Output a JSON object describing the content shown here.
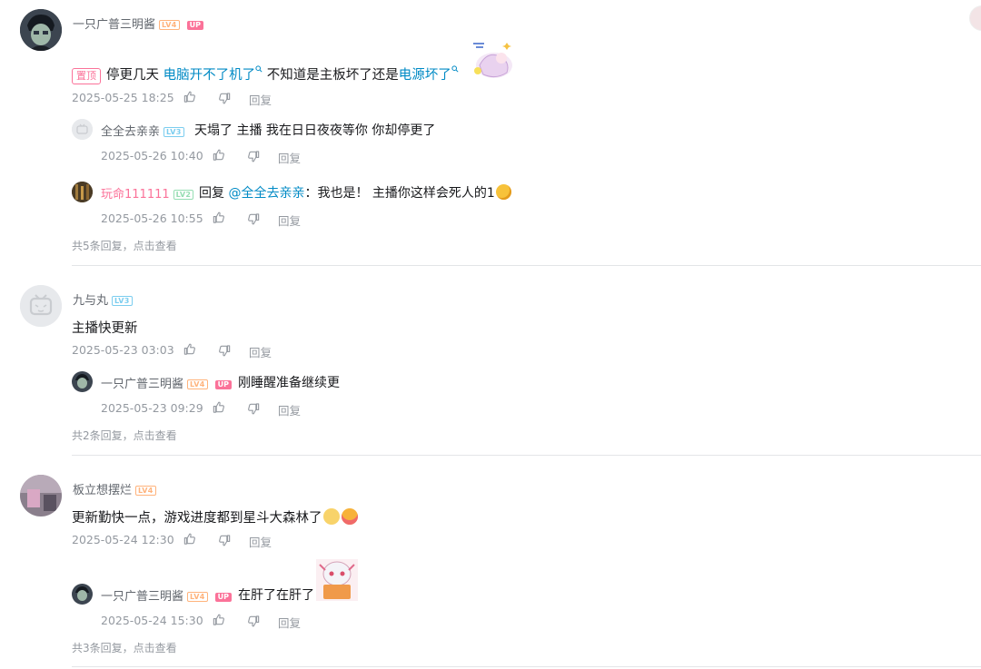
{
  "comments": [
    {
      "user": "一只广普三明酱",
      "level": "LV4",
      "up_badge": "UP",
      "pinned_label": "置顶",
      "text_parts": [
        "停更几天",
        "电脑开不了机了",
        "不知道是主板坏了还是",
        "电源坏了"
      ],
      "time": "2025-05-25 18:25",
      "reply_label": "回复",
      "replies": [
        {
          "user": "全全去亲亲",
          "level": "LV3",
          "text": "天塌了 主播 我在日日夜夜等你 你却停更了",
          "time": "2025-05-26 10:40",
          "reply_label": "回复"
        },
        {
          "user": "玩命111111",
          "level": "LV2",
          "prefix": "回复",
          "mention": "@全全去亲亲",
          "text": "：我也是！ 主播你这样会死人的1",
          "time": "2025-05-26 10:55",
          "reply_label": "回复"
        }
      ],
      "view_more": "共5条回复，点击查看"
    },
    {
      "user": "九与丸",
      "level": "LV3",
      "text": "主播快更新",
      "time": "2025-05-23 03:03",
      "reply_label": "回复",
      "replies": [
        {
          "user": "一只广普三明酱",
          "level": "LV4",
          "up_badge": "UP",
          "text": "刚睡醒准备继续更",
          "time": "2025-05-23 09:29",
          "reply_label": "回复"
        }
      ],
      "view_more": "共2条回复，点击查看"
    },
    {
      "user": "板立想摆烂",
      "level": "LV4",
      "text": "更新勤快一点，游戏进度都到星斗大森林了",
      "time": "2025-05-24 12:30",
      "reply_label": "回复",
      "replies": [
        {
          "user": "一只广普三明酱",
          "level": "LV4",
          "up_badge": "UP",
          "text": "在肝了在肝了",
          "time": "2025-05-24 15:30",
          "reply_label": "回复"
        }
      ],
      "view_more": "共3条回复，点击查看"
    }
  ],
  "colors": {
    "link_blue": "#008ac5",
    "pink": "#fb7299",
    "gray": "#9499a0"
  },
  "icons": [
    "like-icon",
    "dislike-icon",
    "search-link-icon",
    "tv-placeholder-icon"
  ]
}
